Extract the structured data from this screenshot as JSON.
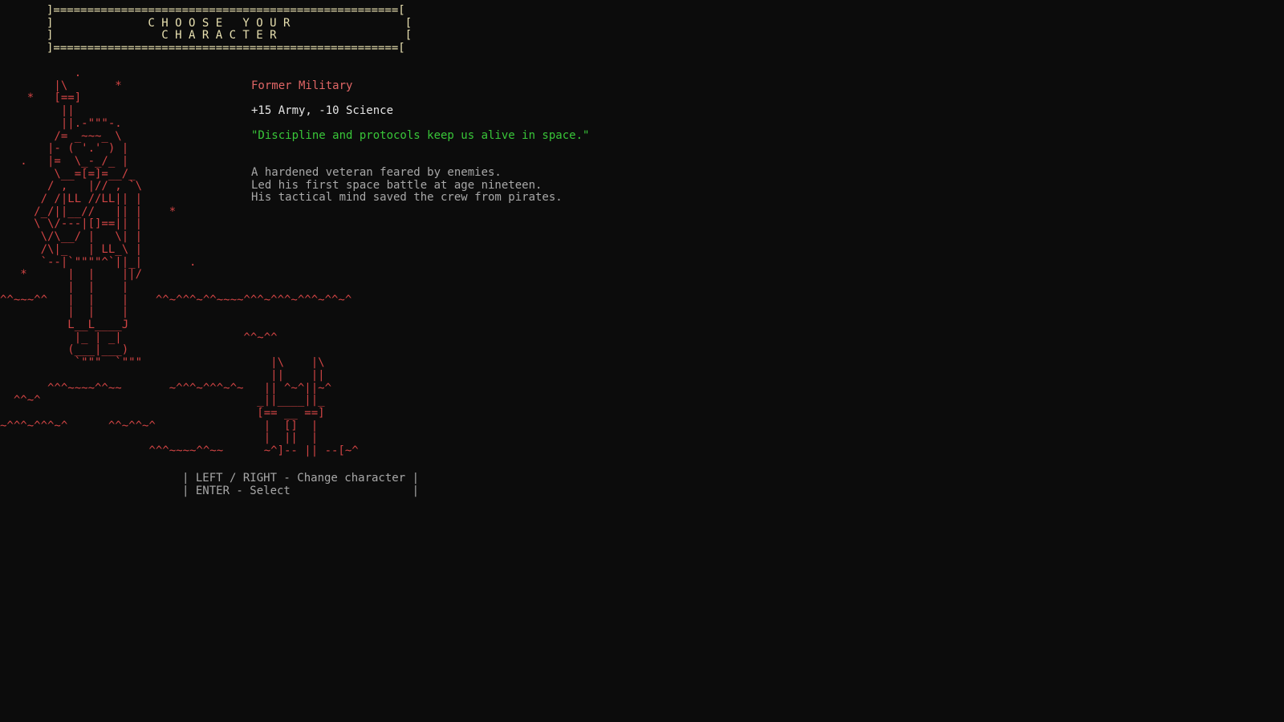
{
  "title": {
    "border_top": "]===================================================[",
    "line1": "]              C H O O S E   Y O U R                 [",
    "line2": "]                C H A R A C T E R                   [",
    "border_bottom": "]===================================================["
  },
  "character": {
    "name": "Former Military",
    "stats": "+15 Army, -10 Science",
    "quote": "\"Discipline and protocols keep us alive in space.\"",
    "bio": [
      "A hardened veteran feared by enemies.",
      "Led his first space battle at age nineteen.",
      "His tactical mind saved the crew from pirates."
    ]
  },
  "scene_art": [
    "           .",
    "        |\\       *",
    "    *   [==]",
    "         ||",
    "         ||.-\"\"\"-.",
    "        /= _~~~_ \\",
    "       |- ( '.' ) |",
    "   .   |=  \\_-_/_ |",
    "        \\__=[=]=__/_",
    "       / ,   |// , `\\",
    "      / /|LL //LL|| |",
    "     /_/||__//   || |    *",
    "     \\ \\/---|[]==|| |",
    "      \\/\\__/ |   \\| |",
    "      /\\|_   | LL_\\ |",
    "      `--|`\"\"\"\"^`||_|       .",
    "   *      |  |    ||/",
    "          |  |    |",
    "^^~~~^^   |  |    |    ^^~^^^~^^~~~~^^^~^^^~^^^~^^~^",
    "          |  |    |",
    "          L__L____J",
    "           |_ | _|                  ^^~^^",
    "          (___|___)",
    "           `\"\"\"  `\"\"\"                   |\\    |\\",
    "                                        ||    ||",
    "       ^^^~~~~^^~~       ~^^^~^^^~^~   || ^~^||~^",
    "  ^^~^                                _||____||_",
    "                                      [== __ ==]",
    "~^^^~^^^~^      ^^~^^~^                |  []  |",
    "                                       |  ||  |",
    "                      ^^^~~~~^^~~      ~^]-- || --[~^"
  ],
  "controls": [
    "| LEFT / RIGHT - Change character |",
    "| ENTER - Select                  |"
  ],
  "colors": {
    "background": "#0c0c0c",
    "title": "#e8e0b0",
    "name": "#e06666",
    "quote": "#39c639",
    "art": "#d04444",
    "bio": "#a8a8a8"
  }
}
